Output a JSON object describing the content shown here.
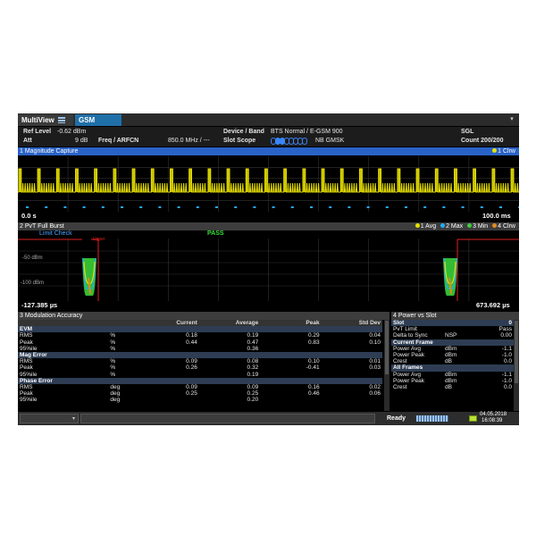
{
  "window": {
    "tab_multiview": "MultiView",
    "tab_gsm": "GSM",
    "menu_icon": "chevron-down-icon"
  },
  "info": {
    "ref_level_label": "Ref Level",
    "ref_level_value": "-0.62 dBm",
    "att_label": "Att",
    "att_value": "9 dB",
    "freq_label": "Freq / ARFCN",
    "freq_value": "850.0 MHz / ---",
    "device_label": "Device / Band",
    "device_value": "BTS Normal / E-GSM 900",
    "slot_scope_label": "Slot Scope",
    "slot_scope_value": "NB GMSK",
    "mode": "SGL",
    "count": "Count 200/200"
  },
  "mag": {
    "title": "1 Magnitude Capture",
    "legend": "1 Clrw",
    "x_start": "0.0 s",
    "x_end": "100.0 ms",
    "trace_color": "#e8e000",
    "marker_color": "#22aaff"
  },
  "pvt": {
    "title": "2 PvT Full Burst",
    "legend": [
      "1 Avg",
      "2 Max",
      "3 Min",
      "4 Clrw"
    ],
    "legend_colors": [
      "#e8e000",
      "#22aaff",
      "#39d039",
      "#e08b1f"
    ],
    "limit_check": "Limit Check",
    "pass": "PASS",
    "upper": "Upper",
    "y_ticks": [
      "-50 dBm",
      "-100 dBm"
    ],
    "x_start": "-127.385 µs",
    "x_end": "673.692 µs",
    "limit_color": "#e02020"
  },
  "mod": {
    "title": "3 Modulation Accuracy",
    "columns": [
      "",
      "",
      "Current",
      "Average",
      "Peak",
      "Std Dev"
    ],
    "rows": [
      {
        "section": true,
        "label": "EVM"
      },
      {
        "label": "RMS",
        "unit": "%",
        "cur": "0.18",
        "avg": "0.19",
        "peak": "0.29",
        "std": "0.04"
      },
      {
        "label": "Peak",
        "unit": "%",
        "cur": "0.44",
        "avg": "0.47",
        "peak": "0.83",
        "std": "0.10"
      },
      {
        "label": "95%ile",
        "unit": "%",
        "cur": "",
        "avg": "0.36",
        "peak": "",
        "std": ""
      },
      {
        "section": true,
        "label": "Mag Error"
      },
      {
        "label": "RMS",
        "unit": "%",
        "cur": "0.09",
        "avg": "0.08",
        "peak": "0.10",
        "std": "0.01"
      },
      {
        "label": "Peak",
        "unit": "%",
        "cur": "0.26",
        "avg": "0.32",
        "peak": "-0.41",
        "std": "0.03"
      },
      {
        "label": "95%ile",
        "unit": "%",
        "cur": "",
        "avg": "0.19",
        "peak": "",
        "std": ""
      },
      {
        "section": true,
        "label": "Phase Error"
      },
      {
        "label": "RMS",
        "unit": "deg",
        "cur": "0.09",
        "avg": "0.09",
        "peak": "0.16",
        "std": "0.02"
      },
      {
        "label": "Peak",
        "unit": "deg",
        "cur": "0.25",
        "avg": "0.25",
        "peak": "0.46",
        "std": "0.06"
      },
      {
        "label": "95%ile",
        "unit": "deg",
        "cur": "",
        "avg": "0.20",
        "peak": "",
        "std": ""
      }
    ]
  },
  "pvs": {
    "title": "4 Power vs Slot",
    "rows": [
      {
        "section": true,
        "label": "Slot",
        "unit": "",
        "val": "0"
      },
      {
        "label": "PvT Limit",
        "unit": "",
        "val": "Pass"
      },
      {
        "label": "Delta to Sync",
        "unit": "NSP",
        "val": "0.00"
      },
      {
        "section": true,
        "label": "Current Frame",
        "unit": "",
        "val": ""
      },
      {
        "label": "Power Avg",
        "unit": "dBm",
        "val": "-1.1"
      },
      {
        "label": "Power Peak",
        "unit": "dBm",
        "val": "-1.0"
      },
      {
        "label": "Crest",
        "unit": "dB",
        "val": "0.0"
      },
      {
        "section": true,
        "label": "All Frames",
        "unit": "",
        "val": ""
      },
      {
        "label": "Power Avg",
        "unit": "dBm",
        "val": "-1.1"
      },
      {
        "label": "Power Peak",
        "unit": "dBm",
        "val": "-1.0"
      },
      {
        "label": "Crest",
        "unit": "dB",
        "val": "0.0"
      }
    ]
  },
  "status": {
    "ready": "Ready",
    "date": "04.05.2018",
    "time": "16:08:39"
  }
}
